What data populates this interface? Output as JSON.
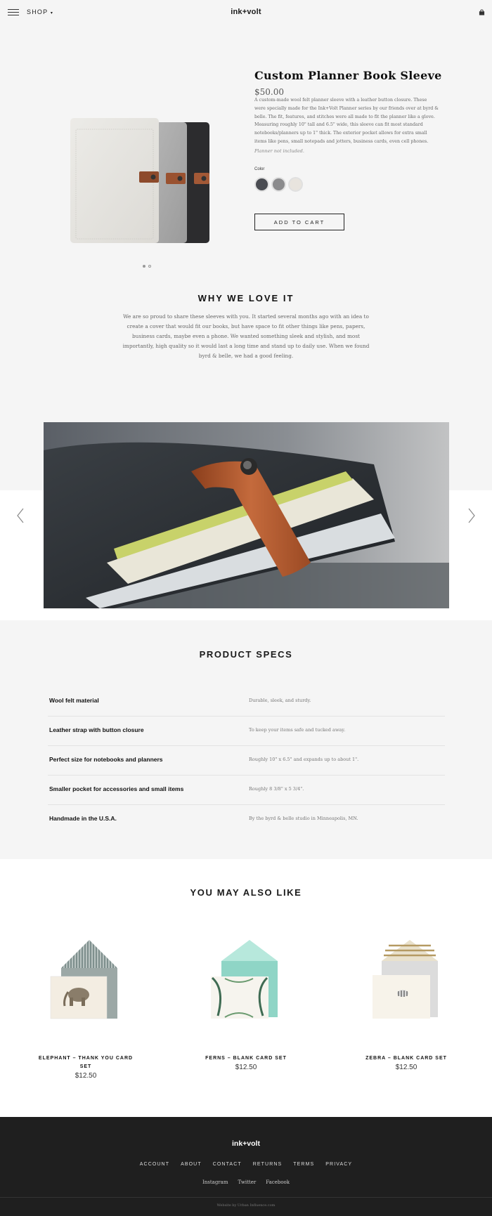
{
  "header": {
    "shop_label": "SHOP",
    "logo": "ink+volt"
  },
  "product": {
    "title": "Custom Planner Book Sleeve",
    "price": "$50.00",
    "description": "A custom-made wool felt planner sleeve with a leather button closure. These were specially made for the Ink+Volt Planner series by our friends over at byrd & belle. The fit, features, and stitches were all made to fit the planner like a glove. Measuring roughly 10\" tall and 6.5\" wide, this sleeve can fit most standard notebooks/planners up to 1\" thick. The exterior pocket allows for extra small items like pens, small notepads and jotters, business cards, even cell phones.",
    "note": "Planner not included.",
    "color_label": "Color",
    "swatches": [
      {
        "name": "charcoal",
        "color": "#4a4c52"
      },
      {
        "name": "gray",
        "color": "#8b8b8d"
      },
      {
        "name": "oatmeal",
        "color": "#e8e4de"
      }
    ],
    "add_to_cart": "ADD TO CART"
  },
  "why": {
    "title": "WHY WE LOVE IT",
    "text": "We are so proud to share these sleeves with you. It started several months ago with an idea to create a cover that would fit our books, but have space to fit other things like pens, papers, business cards, maybe even a phone. We wanted something sleek and stylish, and most importantly, high quality so it would last a long time and stand up to daily use. When we found byrd & belle, we had a good feeling."
  },
  "specs": {
    "title": "PRODUCT SPECS",
    "rows": [
      {
        "name": "Wool felt material",
        "value": "Durable, sleek, and sturdy."
      },
      {
        "name": "Leather strap with button closure",
        "value": "To keep your items safe and tucked away."
      },
      {
        "name": "Perfect size for notebooks and planners",
        "value": "Roughly 10\" x 6.5\" and expands up to about 1\"."
      },
      {
        "name": "Smaller pocket for accessories and small items",
        "value": "Roughly 8 3/8\" x 5 3/4\"."
      },
      {
        "name": "Handmade in the U.S.A.",
        "value": "By the byrd & belle studio in Minneapolis, MN."
      }
    ]
  },
  "also": {
    "title": "YOU MAY ALSO LIKE",
    "items": [
      {
        "name": "ELEPHANT – THANK YOU CARD SET",
        "price": "$12.50"
      },
      {
        "name": "FERNS – BLANK CARD SET",
        "price": "$12.50"
      },
      {
        "name": "ZEBRA – BLANK CARD SET",
        "price": "$12.50"
      }
    ]
  },
  "footer": {
    "logo": "ink+volt",
    "links": [
      "ACCOUNT",
      "ABOUT",
      "CONTACT",
      "RETURNS",
      "TERMS",
      "PRIVACY"
    ],
    "social": [
      "Instagram",
      "Twitter",
      "Facebook"
    ],
    "credit": "Website by Urban Influence.com"
  }
}
